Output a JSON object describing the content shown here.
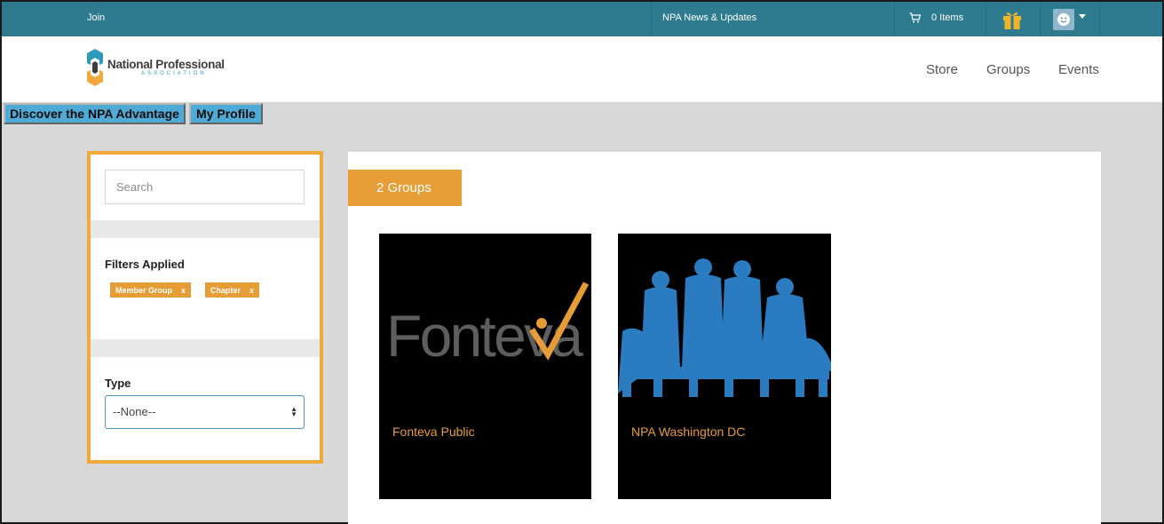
{
  "topbar": {
    "join_label": "Join",
    "news_label": "NPA News & Updates",
    "cart_label": "0 Items"
  },
  "logo": {
    "name": "National Professional",
    "sub": "ASSOCIATION"
  },
  "nav": {
    "items": [
      "Store",
      "Groups",
      "Events"
    ]
  },
  "links": {
    "advantage": "Discover the NPA Advantage",
    "profile": "My Profile"
  },
  "filters": {
    "search_placeholder": "Search",
    "applied_title": "Filters Applied",
    "tags": [
      "Member Group",
      "Chapter"
    ],
    "tag_remove": "x",
    "type_title": "Type",
    "type_value": "--None--"
  },
  "groups": {
    "count_label": "2 Groups",
    "items": [
      {
        "name": "Fonteva Public",
        "logo_text": "Fonteva"
      },
      {
        "name": "NPA Washington DC"
      }
    ]
  },
  "colors": {
    "topbar": "#2e7a8f",
    "accent": "#e79d36",
    "link_button": "#4faad5",
    "group_image": "#2a7bbf"
  }
}
